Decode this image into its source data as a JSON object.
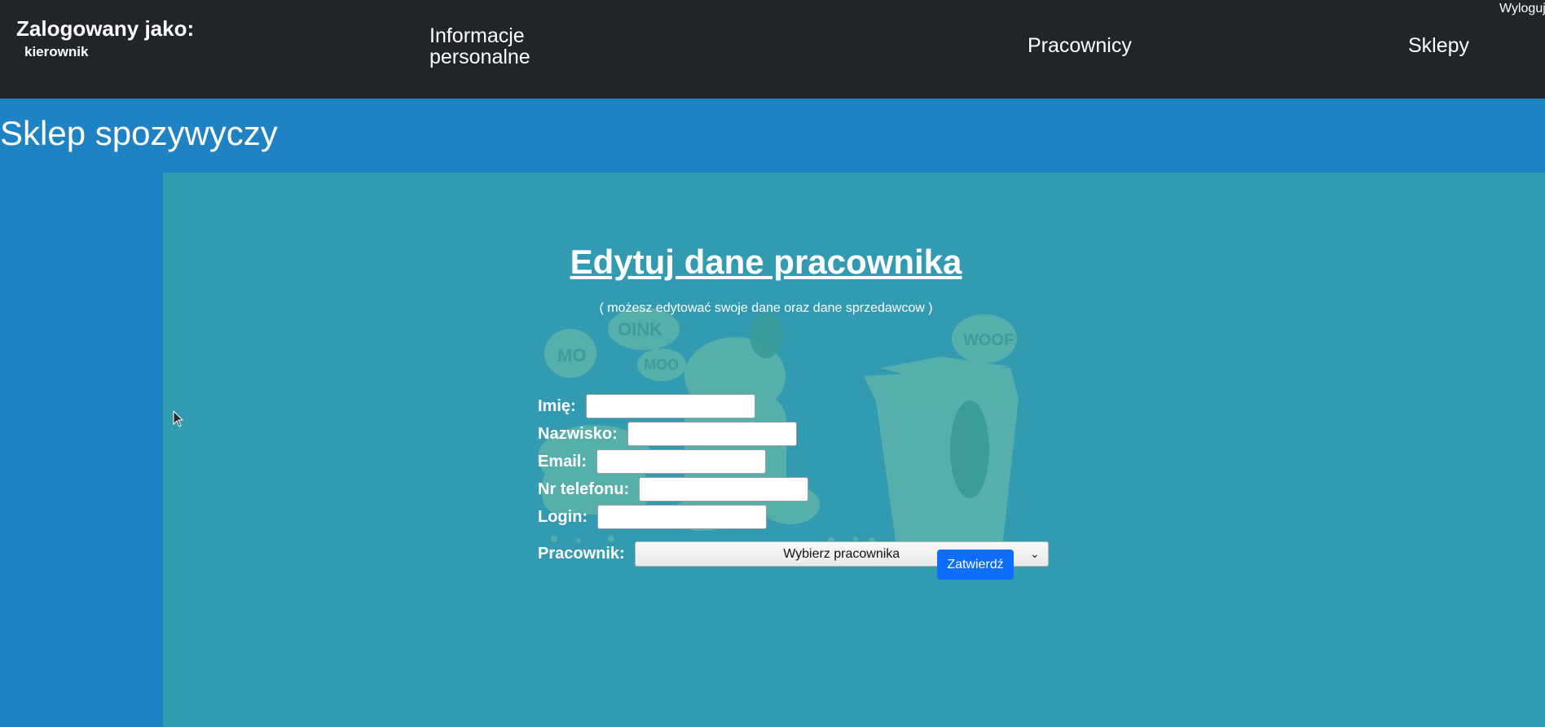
{
  "topbar": {
    "logged_in_label": "Zalogowany jako:",
    "user_name": "kierownik",
    "nav_items": [
      {
        "label": "Informacje personalne"
      },
      {
        "label": "Pracownicy"
      },
      {
        "label": "Sklepy"
      }
    ],
    "logout_label": "Wyloguj"
  },
  "header": {
    "store_title": "Sklep spozywyczy"
  },
  "form": {
    "title": "Edytuj dane pracownika",
    "subtitle": "( możesz edytować swoje dane oraz dane sprzedawcow )",
    "employee_label": "Pracownik:",
    "employee_select_value": "Wybierz pracownika",
    "first_name_label": "Imię:",
    "first_name_value": "",
    "last_name_label": "Nazwisko:",
    "last_name_value": "",
    "email_label": "Email:",
    "email_value": "",
    "phone_label": "Nr telefonu:",
    "phone_value": "",
    "login_label": "Login:",
    "login_value": "",
    "submit_label": "Zatwierdź"
  },
  "icons": {
    "dropdown": "chevron-down-icon",
    "cursor": "mouse-cursor-icon",
    "background": "food-doodle-illustration"
  },
  "colors": {
    "topbar": "#212529",
    "page_bg": "#1e82c3",
    "panel_bg": "#339bb1",
    "submit_button": "#0d6efd"
  }
}
